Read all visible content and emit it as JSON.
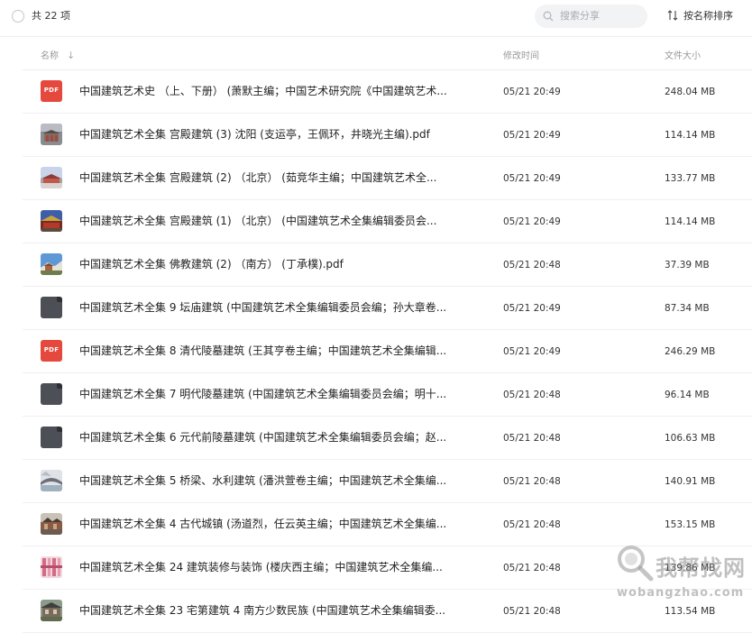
{
  "toolbar": {
    "count_label": "共 22 项",
    "search_placeholder": "搜索分享",
    "sort_label": "按名称排序"
  },
  "columns": {
    "name": "名称",
    "sort_arrow": "↓",
    "time": "修改时间",
    "size": "文件大小"
  },
  "files": [
    {
      "name": "中国建筑艺术史 （上、下册） (萧默主编；中国艺术研究院《中国建筑艺术...",
      "time": "05/21 20:49",
      "size": "248.04 MB",
      "thumb": "pdf-icon"
    },
    {
      "name": "中国建筑艺术全集 宫殿建筑 (3) 沈阳 (支运亭，王佩环，井晓光主编).pdf",
      "time": "05/21 20:49",
      "size": "114.14 MB",
      "thumb": "palace-image-icon"
    },
    {
      "name": "中国建筑艺术全集 宫殿建筑 (2) （北京） (茹竞华主编；中国建筑艺术全...",
      "time": "05/21 20:49",
      "size": "133.77 MB",
      "thumb": "palace-image-icon"
    },
    {
      "name": "中国建筑艺术全集 宫殿建筑 (1) （北京） (中国建筑艺术全集编辑委员会...",
      "time": "05/21 20:49",
      "size": "114.14 MB",
      "thumb": "palace-image-icon"
    },
    {
      "name": "中国建筑艺术全集 佛教建筑 (2) （南方） (丁承樸).pdf",
      "time": "05/21 20:48",
      "size": "37.39 MB",
      "thumb": "temple-image-icon"
    },
    {
      "name": "中国建筑艺术全集 9 坛庙建筑 (中国建筑艺术全集编辑委员会编；孙大章卷...",
      "time": "05/21 20:49",
      "size": "87.34 MB",
      "thumb": "document-icon"
    },
    {
      "name": "中国建筑艺术全集 8 清代陵墓建筑 (王其亨卷主编；中国建筑艺术全集编辑...",
      "time": "05/21 20:49",
      "size": "246.29 MB",
      "thumb": "pdf-icon"
    },
    {
      "name": "中国建筑艺术全集 7 明代陵墓建筑 (中国建筑艺术全集编辑委员会编；明十...",
      "time": "05/21 20:48",
      "size": "96.14 MB",
      "thumb": "document-icon"
    },
    {
      "name": "中国建筑艺术全集 6 元代前陵墓建筑 (中国建筑艺术全集编辑委员会编；赵...",
      "time": "05/21 20:48",
      "size": "106.63 MB",
      "thumb": "document-icon"
    },
    {
      "name": "中国建筑艺术全集 5 桥梁、水利建筑 (潘洪萱卷主编；中国建筑艺术全集编...",
      "time": "05/21 20:48",
      "size": "140.91 MB",
      "thumb": "bridge-image-icon"
    },
    {
      "name": "中国建筑艺术全集 4 古代城镇 (汤道烈，任云英主编；中国建筑艺术全集编...",
      "time": "05/21 20:48",
      "size": "153.15 MB",
      "thumb": "city-image-icon"
    },
    {
      "name": "中国建筑艺术全集 24 建筑装修与装饰 (楼庆西主编；中国建筑艺术全集编...",
      "time": "05/21 20:48",
      "size": "139.86 MB",
      "thumb": "decoration-image-icon"
    },
    {
      "name": "中国建筑艺术全集 23 宅第建筑 4 南方少数民族 (中国建筑艺术全集编辑委...",
      "time": "05/21 20:48",
      "size": "113.54 MB",
      "thumb": "house-image-icon"
    }
  ],
  "watermark": {
    "brand": "我帮找网",
    "domain": "wobangzhao.com"
  }
}
